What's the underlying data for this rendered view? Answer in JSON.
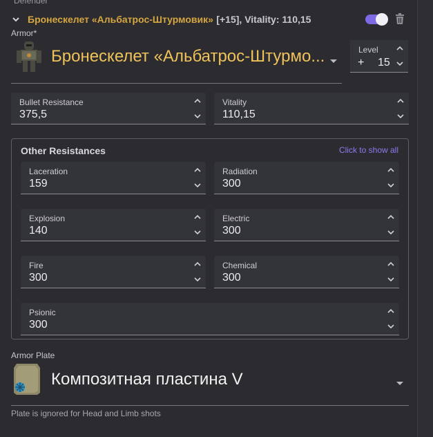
{
  "section": {
    "label": "Defender"
  },
  "header": {
    "title": "Бронескелет «Альбатрос-Штурмовик»",
    "rest": "[+15], Vitality: 110,15"
  },
  "armor": {
    "label": "Armor*",
    "name": "Бронескелет «Альбатрос-Штурмо...",
    "level_label": "Level",
    "level_prefix": "+",
    "level_value": "15"
  },
  "stats": {
    "bullet": {
      "label": "Bullet Resistance",
      "value": "375,5"
    },
    "vitality": {
      "label": "Vitality",
      "value": "110,15"
    }
  },
  "other": {
    "title": "Other Resistances",
    "show_all": "Click to show all",
    "items": [
      {
        "label": "Laceration",
        "value": "159"
      },
      {
        "label": "Radiation",
        "value": "300"
      },
      {
        "label": "Explosion",
        "value": "140"
      },
      {
        "label": "Electric",
        "value": "300"
      },
      {
        "label": "Fire",
        "value": "300"
      },
      {
        "label": "Chemical",
        "value": "300"
      },
      {
        "label": "Psionic",
        "value": "300"
      }
    ]
  },
  "plate": {
    "label": "Armor Plate",
    "name": "Композитная пластина V",
    "hint": "Plate is ignored for Head and Limb shots"
  },
  "colors": {
    "accent": "#7f6ae6",
    "armor_gold": "#efc25a",
    "header_gold": "#d6a640"
  },
  "icons": {
    "expand": "chevron-down-icon",
    "delete": "trash-icon",
    "toggle": "toggle-switch",
    "step_up": "chevron-up-icon",
    "step_down": "chevron-down-icon"
  }
}
